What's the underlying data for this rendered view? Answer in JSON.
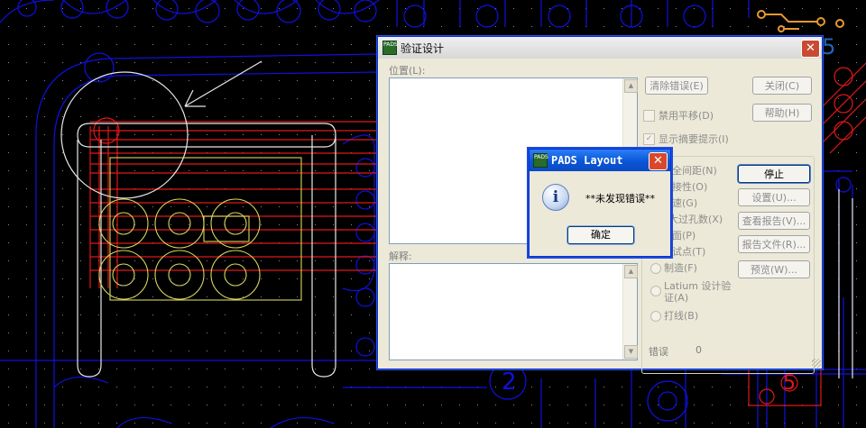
{
  "main_dialog": {
    "title": "验证设计",
    "app_icon_text": "PADS",
    "close_glyph": "✕",
    "location_label": "位置(L):",
    "explanation_label": "解释:",
    "buttons": {
      "clear_errors": "清除错误(E)",
      "close": "关闭(C)",
      "help": "帮助(H)",
      "stop": "停止",
      "setup": "设置(U)...",
      "view_report": "查看报告(V)...",
      "report_file": "报告文件(R)...",
      "preview": "预览(W)..."
    },
    "checkboxes": {
      "disable_pan": "禁用平移(D)",
      "show_summary": "显示摘要提示(I)"
    },
    "options": [
      "全间距(N)",
      "接性(O)",
      "速(G)",
      "大过孔数(X)",
      "面(P)",
      "试点(T)",
      "制造(F)",
      "Latium 设计验证(A)",
      "打线(B)"
    ],
    "errors_label": "错误",
    "errors_count": "0"
  },
  "message_box": {
    "title": "PADS Layout",
    "app_icon_text": "PADS",
    "icon": "information-icon",
    "icon_glyph": "i",
    "message": "**未发现错误**",
    "ok_label": "确定",
    "close_glyph": "✕"
  },
  "watermark": {
    "text": "EDA365"
  },
  "board_labels": {
    "label_2": "2",
    "label_5": "5"
  },
  "colors": {
    "background": "#000000",
    "blue_outline": "#1010e0",
    "red_trace": "#e01818",
    "yellow_outline": "#d8d860",
    "white_outline": "#e8e8e8",
    "dialog_face": "#ece9d8",
    "titlebar_active": "#0b56d6"
  }
}
